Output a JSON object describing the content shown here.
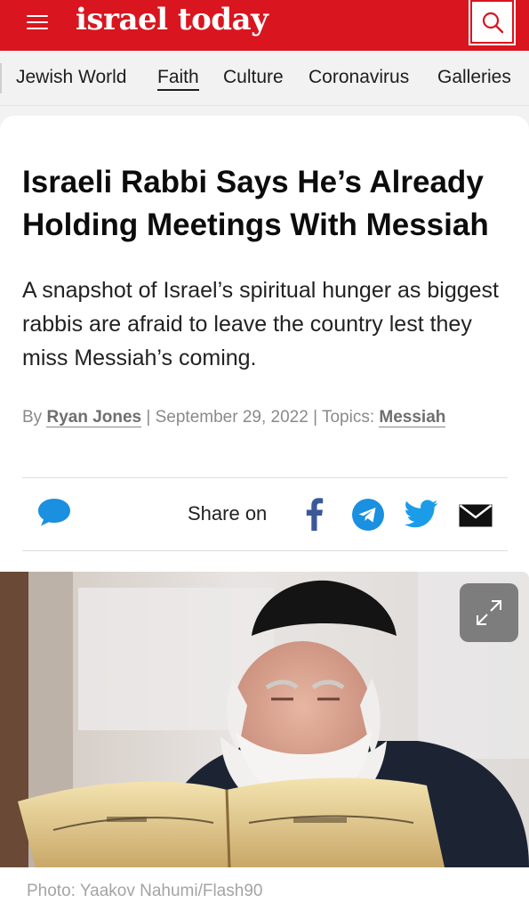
{
  "header": {
    "logo_text": "israel today",
    "brand_color": "#d9151f",
    "menu_icon": "hamburger-icon",
    "search_icon": "search-icon"
  },
  "nav": {
    "items": [
      {
        "label": "Jewish World"
      },
      {
        "label": "Faith",
        "active": true
      },
      {
        "label": "Culture"
      },
      {
        "label": "Coronavirus"
      },
      {
        "label": "Galleries"
      }
    ]
  },
  "article": {
    "title": "Israeli Rabbi Says He’s Already Holding Meetings With Messiah",
    "subtitle": "A snapshot of Israel’s spiritual hunger as biggest rabbis are afraid to leave the country lest they miss Messiah’s coming.",
    "byline": {
      "by_prefix": "By",
      "author": "Ryan Jones",
      "sep1": "|",
      "date": "September 29, 2022",
      "sep2": "|",
      "topics_prefix": "Topics:",
      "topic": "Messiah"
    },
    "share": {
      "label": "Share on",
      "icons": [
        "facebook-icon",
        "telegram-icon",
        "twitter-icon",
        "email-icon"
      ],
      "comment_icon": "comment-icon",
      "accent_color": "#1b8fe0"
    },
    "photo": {
      "credit": "Photo: Yaakov Nahumi/Flash90",
      "expand_icon": "expand-icon"
    }
  }
}
